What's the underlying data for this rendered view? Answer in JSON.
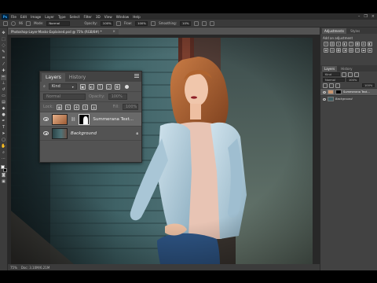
{
  "window": {
    "ps_logo": "Ps",
    "menu": [
      "File",
      "Edit",
      "Image",
      "Layer",
      "Type",
      "Select",
      "Filter",
      "3D",
      "View",
      "Window",
      "Help"
    ],
    "controls": [
      "–",
      "❐",
      "×"
    ]
  },
  "options_bar": {
    "brush_size": "96",
    "mode_label": "Mode:",
    "mode_value": "Normal",
    "opacity_label": "Opacity:",
    "opacity_value": "100%",
    "flow_label": "Flow:",
    "flow_value": "100%",
    "smoothing_label": "Smoothing:",
    "smoothing_value": "10%"
  },
  "document": {
    "tab_title": "Photoshop-Layer-Masks-Explained.psd @ 75% (RGB/8#) *",
    "tab_close": "×"
  },
  "status_bar": {
    "zoom": "75%",
    "doc_info": "Doc: 3.10M/6.21M"
  },
  "layers_panel": {
    "tabs": [
      "Layers",
      "History"
    ],
    "filter_value": "Kind",
    "blend_mode": "Normal",
    "opacity_label": "Opacity:",
    "opacity_value": "100%",
    "lock_label": "Lock:",
    "fill_label": "Fill:",
    "fill_value": "100%",
    "layers": [
      {
        "name": "Summerana Text..."
      },
      {
        "name": "Background"
      }
    ]
  },
  "right_dock": {
    "top_tabs": [
      "Adjustments",
      "Styles"
    ],
    "adjustments_subtitle": "Add an adjustment",
    "layers_tabs": [
      "Layers",
      "History"
    ],
    "filter_value": "Kind",
    "blend_mode": "Normal",
    "opacity_value": "100%",
    "fill_value": "100%",
    "layers": [
      {
        "name": "Summerana Text..."
      },
      {
        "name": "Background"
      }
    ]
  },
  "colors": {
    "app_bg": "#535353",
    "panel_bg": "#535353",
    "selected_row": "#696969",
    "accent_blue": "#31a8ff"
  }
}
